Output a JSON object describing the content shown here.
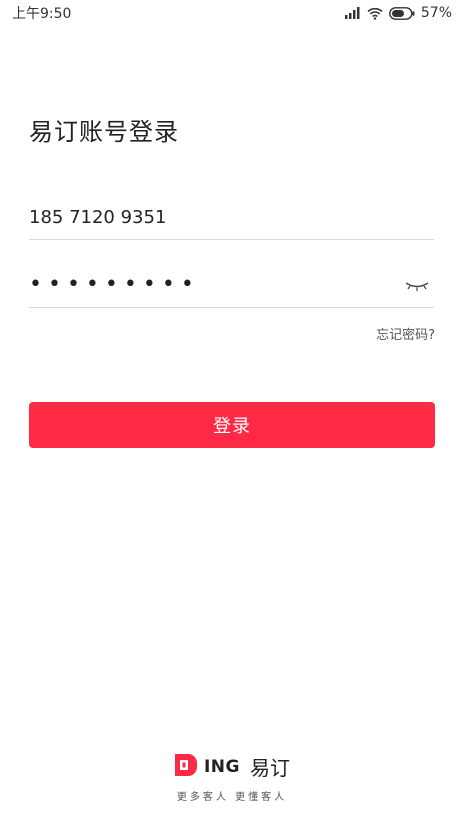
{
  "status_bar": {
    "time": "上午9:50",
    "battery": "57%"
  },
  "login": {
    "title": "易订账号登录",
    "phone_value": "185 7120 9351",
    "password_mask": "•••••••••",
    "forgot_password": "忘记密码?",
    "login_button": "登录"
  },
  "brand": {
    "logo_text": "ING",
    "name": "易订",
    "slogan": "更多客人  更懂客人"
  },
  "colors": {
    "accent": "#fe2a45"
  }
}
